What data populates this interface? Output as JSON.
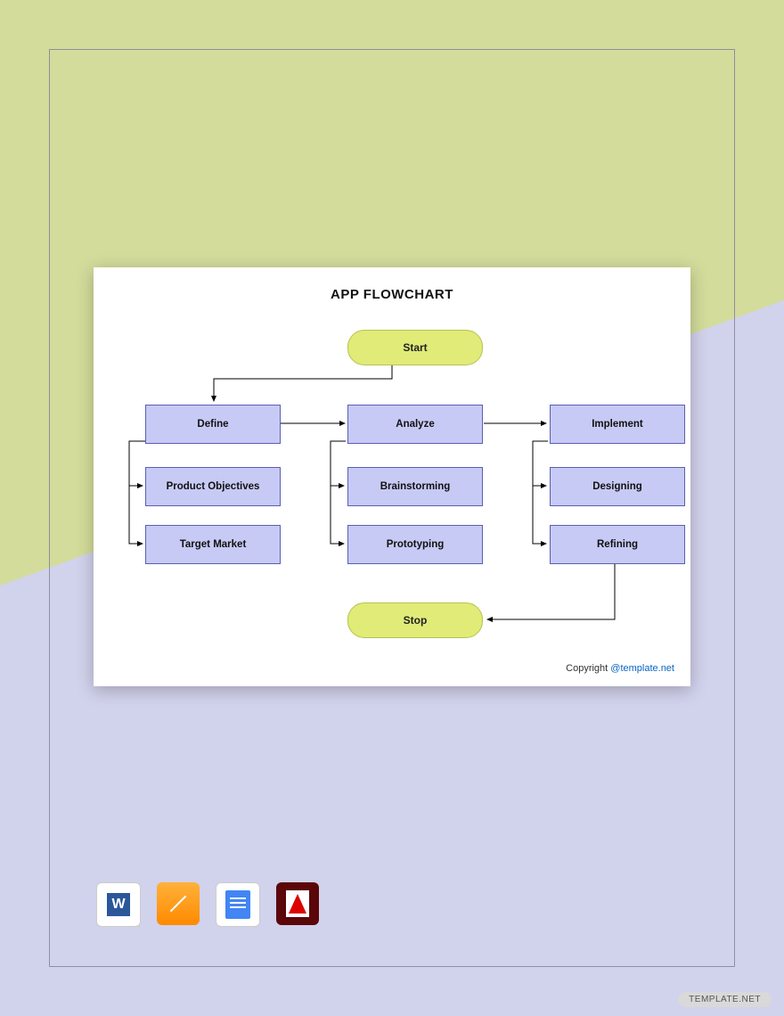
{
  "flowchart": {
    "title": "APP FLOWCHART",
    "start": "Start",
    "stop": "Stop",
    "columns": [
      {
        "head": "Define",
        "items": [
          "Product Objectives",
          "Target Market"
        ]
      },
      {
        "head": "Analyze",
        "items": [
          "Brainstorming",
          "Prototyping"
        ]
      },
      {
        "head": "Implement",
        "items": [
          "Designing",
          "Refining"
        ]
      }
    ],
    "copyright_prefix": "Copyright ",
    "copyright_link_text": "@template.net"
  },
  "apps": {
    "word": "Word",
    "pages": "Pages",
    "gdocs": "Google Docs",
    "pdf": "Adobe PDF"
  },
  "watermark": "TEMPLATE.NET"
}
